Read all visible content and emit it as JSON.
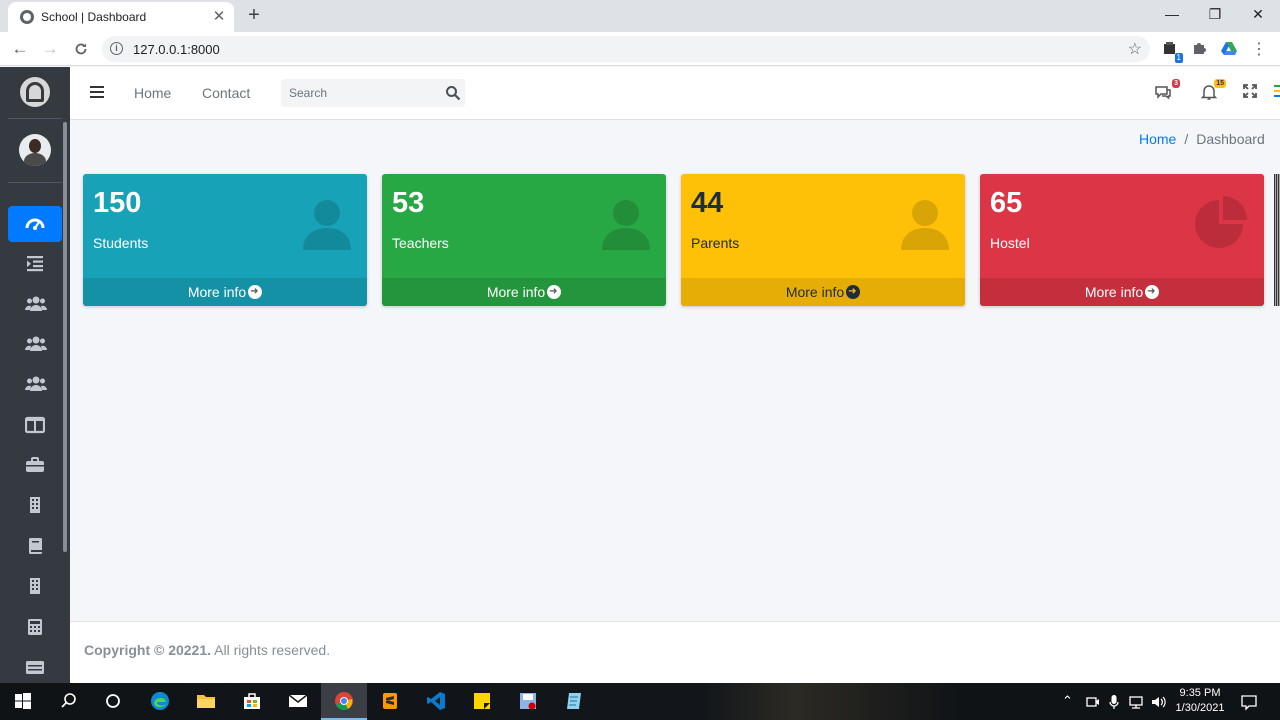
{
  "browser": {
    "tab_title": "School | Dashboard",
    "new_tab": "+",
    "url": "127.0.0.1:8000",
    "minimize": "—",
    "maximize": "❐",
    "close": "✕",
    "back": "←",
    "forward": "→",
    "reload": "C",
    "star": "☆",
    "menu": "⋮",
    "extension_badge": "1"
  },
  "navbar": {
    "links": [
      {
        "label": "Home"
      },
      {
        "label": "Contact"
      }
    ],
    "search_placeholder": "Search",
    "messages_badge": "3",
    "notifications_badge": "15"
  },
  "breadcrumb": {
    "home": "Home",
    "separator": "/",
    "current": "Dashboard"
  },
  "cards": [
    {
      "value": "150",
      "label": "Students",
      "link": "More info",
      "icon": "user-icon",
      "color": "#17a2b8"
    },
    {
      "value": "53",
      "label": "Teachers",
      "link": "More info",
      "icon": "user-icon",
      "color": "#28a745"
    },
    {
      "value": "44",
      "label": "Parents",
      "link": "More info",
      "icon": "user-icon",
      "color": "#ffc107"
    },
    {
      "value": "65",
      "label": "Hostel",
      "link": "More info",
      "icon": "pie-chart-icon",
      "color": "#dc3545"
    }
  ],
  "footer": {
    "copyright": "Copyright © 20221.",
    "rights": "All rights reserved."
  },
  "sidebar": {
    "items": [
      {
        "icon": "dashboard-icon",
        "active": true
      },
      {
        "icon": "list-indent-icon"
      },
      {
        "icon": "users-icon"
      },
      {
        "icon": "users-icon"
      },
      {
        "icon": "users-icon"
      },
      {
        "icon": "columns-icon"
      },
      {
        "icon": "briefcase-icon"
      },
      {
        "icon": "building-icon"
      },
      {
        "icon": "book-icon"
      },
      {
        "icon": "building-icon"
      },
      {
        "icon": "calculator-icon"
      },
      {
        "icon": "table-icon"
      }
    ]
  },
  "taskbar": {
    "time": "9:35 PM",
    "date": "1/30/2021"
  }
}
